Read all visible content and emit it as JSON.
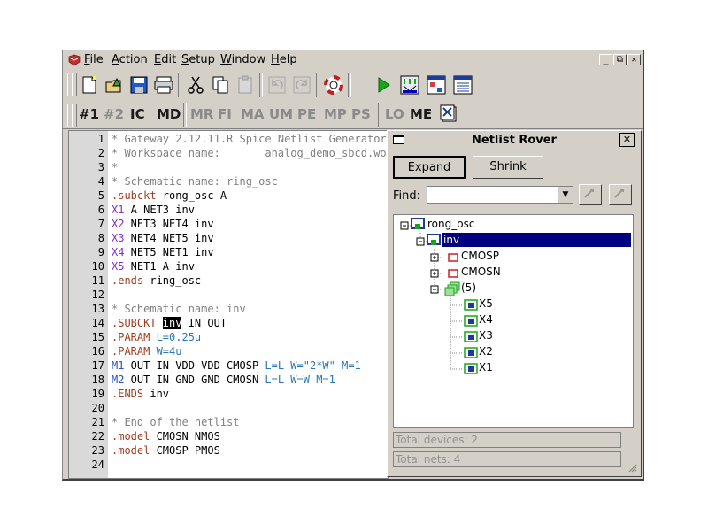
{
  "menu": [
    "File",
    "Action",
    "Edit",
    "Setup",
    "Window",
    "Help"
  ],
  "menu_underline": [
    "F",
    "A",
    "E",
    "S",
    "W",
    "H"
  ],
  "window_controls": {
    "minimize": "_",
    "restore": "⧉",
    "close": "✕"
  },
  "toolbar": {
    "buttons": [
      "new-file-icon",
      "open-file-icon",
      "save-icon",
      "print-icon",
      "cut-icon",
      "copy-icon",
      "paste-icon",
      "undo-icon",
      "redo-icon",
      "help-lifebuoy-icon",
      "run-icon",
      "netlist-icon",
      "hierarchy-icon",
      "window-icon"
    ]
  },
  "workspace_tabs": [
    "#1",
    "#2",
    "IC",
    "MD",
    "MR",
    "FI",
    "MA",
    "UM",
    "PE",
    "MP",
    "PS",
    "LO",
    "ME"
  ],
  "active_tabs": [
    "#1",
    "IC",
    "MD",
    "LO",
    "ME"
  ],
  "editor": {
    "lines": [
      {
        "n": "1",
        "t": "* Gateway 2.12.11.R Spice Netlist Generator"
      },
      {
        "n": "2",
        "t": "* Workspace name:       analog_demo_sbcd.wor"
      },
      {
        "n": "3",
        "t": "*"
      },
      {
        "n": "4",
        "t": "* Schematic name: ring_osc"
      },
      {
        "n": "5",
        "t": ".subckt rong_osc A"
      },
      {
        "n": "6",
        "t": "X1 A NET3 inv"
      },
      {
        "n": "7",
        "t": "X2 NET3 NET4 inv"
      },
      {
        "n": "8",
        "t": "X3 NET4 NET5 inv"
      },
      {
        "n": "9",
        "t": "X4 NET5 NET1 inv"
      },
      {
        "n": "10",
        "t": "X5 NET1 A inv"
      },
      {
        "n": "11",
        "t": ".ends ring_osc"
      },
      {
        "n": "12",
        "t": ""
      },
      {
        "n": "13",
        "t": "* Schematic name: inv"
      },
      {
        "n": "14",
        "t": ".SUBCKT inv IN OUT"
      },
      {
        "n": "15",
        "t": ".PARAM L=0.25u"
      },
      {
        "n": "16",
        "t": ".PARAM W=4u"
      },
      {
        "n": "17",
        "t": "M1 OUT IN VDD VDD CMOSP L=L W=\"2*W\" M=1"
      },
      {
        "n": "18",
        "t": "M2 OUT IN GND GND CMOSN L=L W=W M=1"
      },
      {
        "n": "19",
        "t": ".ENDS inv"
      },
      {
        "n": "20",
        "t": ""
      },
      {
        "n": "21",
        "t": "* End of the netlist"
      },
      {
        "n": "22",
        "t": ".model CMOSN NMOS"
      },
      {
        "n": "23",
        "t": ".model CMOSP PMOS"
      },
      {
        "n": "24",
        "t": ""
      }
    ]
  },
  "rover": {
    "title": "Netlist Rover",
    "expand_label": "Expand",
    "shrink_label": "Shrink",
    "find_label": "Find:",
    "find_value": "",
    "tree": [
      "rong_osc",
      "inv",
      "CMOSP",
      "CMOSN",
      "(5)",
      "X5",
      "X4",
      "X3",
      "X2",
      "X1"
    ],
    "total_devices": "Total devices: 2",
    "total_nets": "Total nets: 4"
  },
  "colors": {
    "window_bg": "#d4d0c8",
    "gutter": "#d9d9d9",
    "comment": "#808080",
    "keyword": "#a23c1e",
    "instance": "#8a2bd2",
    "param": "#2a78b8",
    "selection": "#000080",
    "run_green": "#1aa61a"
  }
}
